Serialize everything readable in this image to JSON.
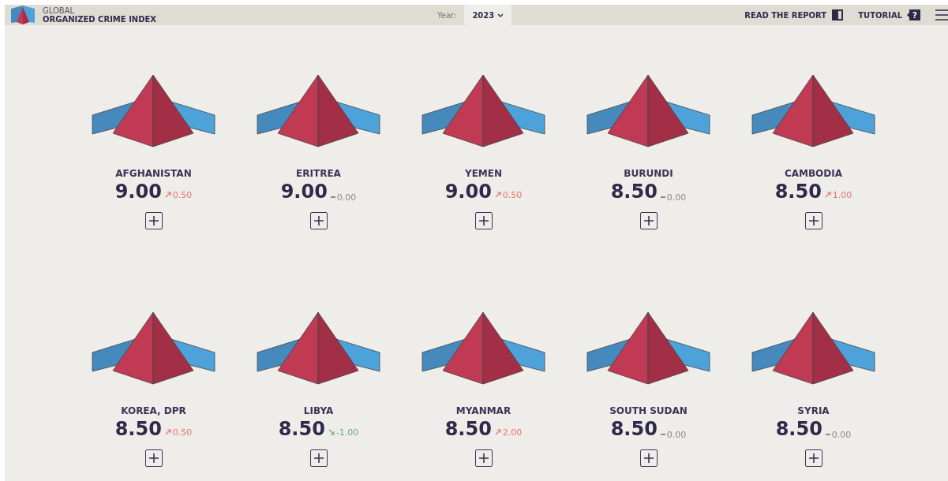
{
  "header": {
    "logo_top": "GLOBAL",
    "logo_bottom": "ORGANIZED CRIME INDEX",
    "year_label": "Year:",
    "year_value": "2023",
    "links": [
      {
        "label": "READ THE REPORT",
        "kind": "book"
      },
      {
        "label": "TUTORIAL",
        "kind": "help",
        "icon_text": "?"
      }
    ]
  },
  "countries": [
    {
      "name": "AFGHANISTAN",
      "score": "9.00",
      "change": "0.50",
      "kind": "up"
    },
    {
      "name": "ERITREA",
      "score": "9.00",
      "change": "0.00",
      "kind": "flat"
    },
    {
      "name": "YEMEN",
      "score": "9.00",
      "change": "0.50",
      "kind": "up"
    },
    {
      "name": "BURUNDI",
      "score": "8.50",
      "change": "0.00",
      "kind": "flat"
    },
    {
      "name": "CAMBODIA",
      "score": "8.50",
      "change": "1.00",
      "kind": "up"
    },
    {
      "name": "KOREA, DPR",
      "score": "8.50",
      "change": "0.50",
      "kind": "up"
    },
    {
      "name": "LIBYA",
      "score": "8.50",
      "change": "-1.00",
      "kind": "down"
    },
    {
      "name": "MYANMAR",
      "score": "8.50",
      "change": "2.00",
      "kind": "up"
    },
    {
      "name": "SOUTH SUDAN",
      "score": "8.50",
      "change": "0.00",
      "kind": "flat"
    },
    {
      "name": "SYRIA",
      "score": "8.50",
      "change": "0.00",
      "kind": "flat"
    }
  ]
}
